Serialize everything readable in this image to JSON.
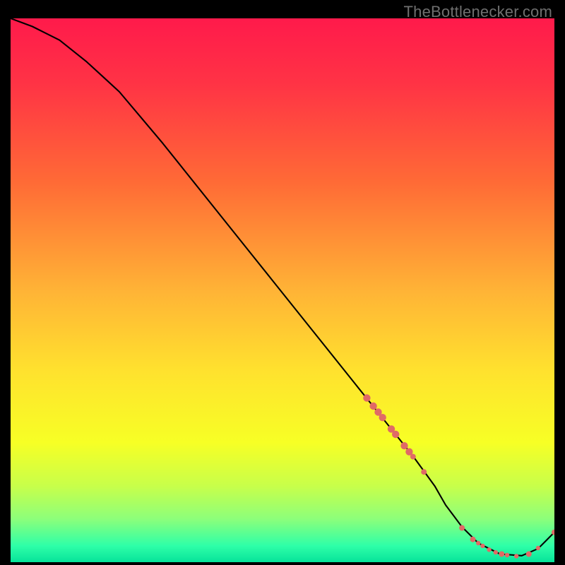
{
  "watermark": "TheBottlenecker.com",
  "chart_data": {
    "type": "line",
    "title": "",
    "xlabel": "",
    "ylabel": "",
    "xlim": [
      0,
      100
    ],
    "ylim": [
      0,
      100
    ],
    "gradient_stops": [
      {
        "offset": 0.0,
        "color": "#ff1a4b"
      },
      {
        "offset": 0.12,
        "color": "#ff3345"
      },
      {
        "offset": 0.3,
        "color": "#ff6a36"
      },
      {
        "offset": 0.5,
        "color": "#ffb336"
      },
      {
        "offset": 0.65,
        "color": "#ffe22e"
      },
      {
        "offset": 0.78,
        "color": "#f7ff25"
      },
      {
        "offset": 0.86,
        "color": "#c8ff4a"
      },
      {
        "offset": 0.92,
        "color": "#8dff7a"
      },
      {
        "offset": 0.97,
        "color": "#2effa8"
      },
      {
        "offset": 1.0,
        "color": "#07e39a"
      }
    ],
    "series": [
      {
        "name": "bottleneck-curve",
        "color": "#000000",
        "x": [
          0,
          4,
          9,
          14,
          20,
          28,
          36,
          44,
          52,
          60,
          66,
          70,
          74,
          78,
          80,
          83,
          86,
          90,
          94,
          97,
          100
        ],
        "y": [
          100,
          98.5,
          96,
          92,
          86.5,
          77,
          67,
          57,
          47,
          37,
          29.5,
          24.5,
          19.5,
          14,
          10.5,
          6.5,
          3.5,
          1.5,
          1.2,
          2.5,
          5.5
        ]
      }
    ],
    "markers": {
      "name": "highlighted-points",
      "color": "#e06a66",
      "points": [
        {
          "x": 65.5,
          "y": 30.2,
          "r": 5.2
        },
        {
          "x": 66.7,
          "y": 28.7,
          "r": 5.2
        },
        {
          "x": 67.6,
          "y": 27.6,
          "r": 5.2
        },
        {
          "x": 68.4,
          "y": 26.6,
          "r": 5.2
        },
        {
          "x": 70.0,
          "y": 24.5,
          "r": 5.2
        },
        {
          "x": 70.8,
          "y": 23.5,
          "r": 5.2
        },
        {
          "x": 72.4,
          "y": 21.4,
          "r": 5.2
        },
        {
          "x": 73.3,
          "y": 20.3,
          "r": 5.2
        },
        {
          "x": 74.0,
          "y": 19.4,
          "r": 4.0
        },
        {
          "x": 76.0,
          "y": 16.6,
          "r": 4.0
        },
        {
          "x": 83.0,
          "y": 6.3,
          "r": 4.0
        },
        {
          "x": 85.0,
          "y": 4.2,
          "r": 4.0
        },
        {
          "x": 86.0,
          "y": 3.5,
          "r": 3.2
        },
        {
          "x": 86.8,
          "y": 3.0,
          "r": 3.2
        },
        {
          "x": 88.0,
          "y": 2.3,
          "r": 3.2
        },
        {
          "x": 89.2,
          "y": 1.8,
          "r": 3.2
        },
        {
          "x": 90.3,
          "y": 1.5,
          "r": 4.0
        },
        {
          "x": 91.3,
          "y": 1.3,
          "r": 3.2
        },
        {
          "x": 93.0,
          "y": 1.1,
          "r": 3.2
        },
        {
          "x": 95.3,
          "y": 1.5,
          "r": 4.0
        },
        {
          "x": 97.0,
          "y": 2.6,
          "r": 3.2
        },
        {
          "x": 100.0,
          "y": 5.5,
          "r": 4.0
        }
      ]
    }
  }
}
